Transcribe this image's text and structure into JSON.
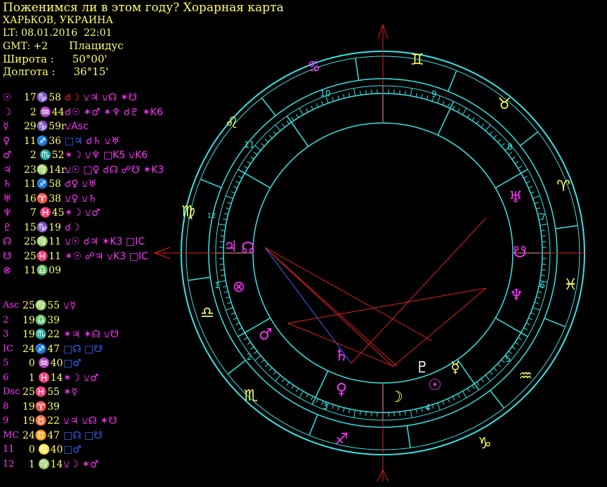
{
  "header": {
    "title": "Поженимся ли в этом году? Хорарная карта",
    "place": "ХАРЬКОВ, УКРАИНА",
    "lt": "LT: 08.01.2016  22:01",
    "gmt": "GMT: +2",
    "system": "Плацидус",
    "lat_label": "Широта :",
    "lat_value": "50°00'",
    "lon_label": "Долгота :",
    "lon_value": "36°15'"
  },
  "colors": {
    "bg": "#000000",
    "text": "#ffff66",
    "glyph": "#ff33ff",
    "blue": "#3366ff",
    "ring": "#33e6e6",
    "axis": "#e02020"
  },
  "planets": [
    {
      "glyph": "☉",
      "name": "sun",
      "pos": "17♑58",
      "asp": [
        {
          "t": "☌☽ ",
          "c": "#ff2222"
        },
        {
          "t": "⚺♃ ⚺☊ ✶☋",
          "c": "#ff33ff"
        }
      ]
    },
    {
      "glyph": "☽",
      "name": "moon",
      "pos": "  2 ♒44",
      "asp": [
        {
          "t": "☌☉ ✶♂ ✶♆ ☌♇ ✶K6",
          "c": "#ff33ff"
        }
      ]
    },
    {
      "glyph": "☿",
      "name": "mercury",
      "pos": "29♑59r",
      "asp": [
        {
          "t": "⚺Asc",
          "c": "#ff33ff"
        }
      ]
    },
    {
      "glyph": "♀",
      "name": "venus",
      "pos": "11♐36",
      "asp": [
        {
          "t": "□♃ ",
          "c": "#3366ff"
        },
        {
          "t": "☌♄ ⚺♅",
          "c": "#ff33ff"
        }
      ]
    },
    {
      "glyph": "♂",
      "name": "mars",
      "pos": "  2 ♏52",
      "asp": [
        {
          "t": "✶☽ ⚺♆ □K5 ⚺K6",
          "c": "#ff33ff"
        }
      ]
    },
    {
      "glyph": "♃",
      "name": "jupiter",
      "pos": "23♍14r",
      "asp": [
        {
          "t": "⚺☉ □♀ ☌☊ ☍☋ ✶K3",
          "c": "#ff33ff"
        }
      ]
    },
    {
      "glyph": "♄",
      "name": "saturn",
      "pos": "11♐58",
      "asp": [
        {
          "t": "☌♀ ⚺♅",
          "c": "#ff33ff"
        }
      ]
    },
    {
      "glyph": "♅",
      "name": "uranus",
      "pos": "16♈38",
      "asp": [
        {
          "t": "⚺♀ ⚺♄",
          "c": "#ff33ff"
        }
      ]
    },
    {
      "glyph": "♆",
      "name": "neptune",
      "pos": "  7 ♓45",
      "asp": [
        {
          "t": "✶☽ ⚺♂",
          "c": "#ff33ff"
        }
      ]
    },
    {
      "glyph": "♇",
      "name": "pluto",
      "pos": "15♑19",
      "asp": [
        {
          "t": "☌☽",
          "c": "#ff33ff"
        }
      ]
    },
    {
      "glyph": "☊",
      "name": "north-node",
      "pos": "25♍11",
      "asp": [
        {
          "t": "⚺☉ ☌♃ ✶K3 □IC",
          "c": "#ff33ff"
        }
      ]
    },
    {
      "glyph": "☋",
      "name": "south-node",
      "pos": "25♓11",
      "asp": [
        {
          "t": "✶☉ ☍♃ ⚺K3 □IC",
          "c": "#ff33ff"
        }
      ]
    },
    {
      "glyph": "⊗",
      "name": "fortune",
      "pos": "11♎09",
      "asp": []
    }
  ],
  "houses": [
    {
      "label": "Asc",
      "pos": "25♍55",
      "asp": [
        {
          "t": "⚺☿",
          "c": "#ff33ff"
        }
      ]
    },
    {
      "label": "2",
      "pos": "19♎39",
      "asp": []
    },
    {
      "label": "3",
      "pos": "19♏22",
      "asp": [
        {
          "t": "✶♃ ✶☊ ⚺☋",
          "c": "#ff33ff"
        }
      ]
    },
    {
      "label": "IC",
      "pos": "24♐47",
      "asp": [
        {
          "t": "□☊ □☋",
          "c": "#3366ff"
        }
      ]
    },
    {
      "label": "5",
      "pos": "  0 ♒40",
      "asp": [
        {
          "t": "□♂",
          "c": "#3366ff"
        }
      ]
    },
    {
      "label": "6",
      "pos": "  1 ♓14",
      "asp": [
        {
          "t": "✶☽ ⚺♂",
          "c": "#ff33ff"
        }
      ]
    },
    {
      "label": "Dsc",
      "pos": "25♓55",
      "asp": [
        {
          "t": "✶☿",
          "c": "#ff33ff"
        }
      ]
    },
    {
      "label": "8",
      "pos": "19♈39",
      "asp": []
    },
    {
      "label": "9",
      "pos": "19♉22",
      "asp": [
        {
          "t": "⚺♃ ⚺☊ ✶☋",
          "c": "#ff33ff"
        }
      ]
    },
    {
      "label": "MC",
      "pos": "24♊47",
      "asp": [
        {
          "t": "□☊ □☋",
          "c": "#3366ff"
        }
      ]
    },
    {
      "label": "11",
      "pos": "  0 ♌40",
      "asp": [
        {
          "t": "□♂",
          "c": "#3366ff"
        }
      ]
    },
    {
      "label": "12",
      "pos": "  1 ♍14",
      "asp": [
        {
          "t": "⚺☽ ✶♂",
          "c": "#ff33ff"
        }
      ]
    }
  ],
  "wheel": {
    "house_numbers": [
      "1",
      "2",
      "3",
      "4",
      "5",
      "6",
      "7",
      "8",
      "9",
      "10",
      "11",
      "12"
    ],
    "signs": [
      "♋",
      "♊",
      "♉",
      "♈",
      "♓",
      "♒",
      "♑",
      "♐",
      "♏",
      "♎",
      "♍",
      "♌"
    ],
    "chart_planets": [
      "♃",
      "☊",
      "⊗",
      "♂",
      "♄",
      "♀",
      "☽",
      "☉",
      "♇",
      "☿",
      "♆",
      "☋",
      "♅"
    ]
  }
}
